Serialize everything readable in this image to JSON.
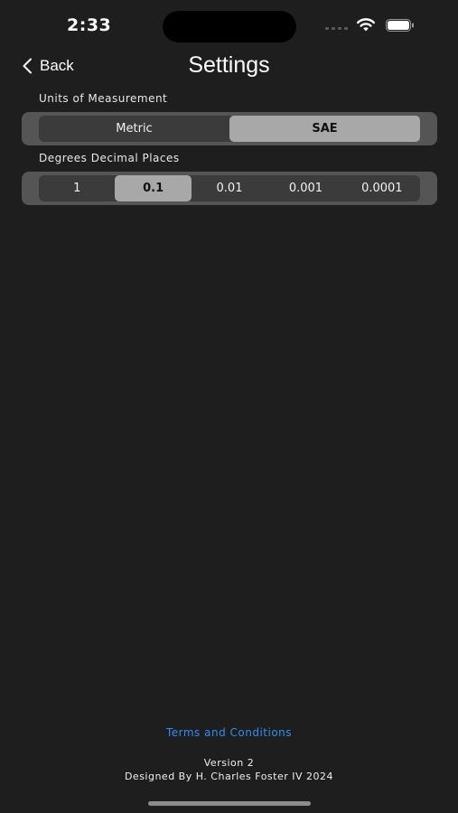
{
  "status_bar": {
    "time": "2:33"
  },
  "nav": {
    "back_label": "Back",
    "title": "Settings"
  },
  "units": {
    "label": "Units of Measurement",
    "options": [
      "Metric",
      "SAE"
    ],
    "selected": "SAE"
  },
  "decimals": {
    "label": "Degrees Decimal Places",
    "options": [
      "1",
      "0.1",
      "0.01",
      "0.001",
      "0.0001"
    ],
    "selected": "0.1"
  },
  "footer": {
    "terms_link": "Terms and Conditions",
    "version": "Version 2",
    "designed_by": "Designed By H. Charles Foster IV 2024"
  },
  "colors": {
    "background": "#1e1e1e",
    "link": "#2f8ff0",
    "selected_segment": "#a8a8a8"
  }
}
